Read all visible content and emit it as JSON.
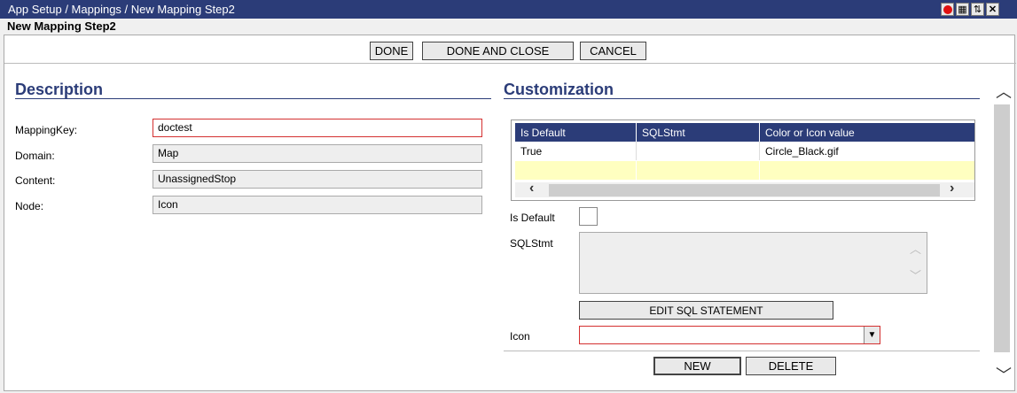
{
  "window": {
    "breadcrumb": "App Setup / Mappings / New Mapping Step2",
    "subtitle": "New Mapping Step2",
    "controls": [
      "record-icon",
      "save-icon",
      "refresh-icon",
      "close-icon"
    ]
  },
  "toolbar": {
    "done_label": "DONE",
    "done_close_label": "DONE AND CLOSE",
    "cancel_label": "CANCEL"
  },
  "description": {
    "title": "Description",
    "fields": {
      "mapping_key": {
        "label": "MappingKey:",
        "value": "doctest"
      },
      "domain": {
        "label": "Domain:",
        "value": "Map"
      },
      "content": {
        "label": "Content:",
        "value": "UnassignedStop"
      },
      "node": {
        "label": "Node:",
        "value": "Icon"
      }
    }
  },
  "customization": {
    "title": "Customization",
    "grid": {
      "columns": [
        "Is Default",
        "SQLStmt",
        "Color or Icon value"
      ],
      "rows": [
        [
          "True",
          "",
          "Circle_Black.gif"
        ],
        [
          "",
          "",
          ""
        ]
      ]
    },
    "is_default_label": "Is Default",
    "sqlstmt_label": "SQLStmt",
    "edit_sql_label": "EDIT SQL STATEMENT",
    "icon_label": "Icon",
    "icon_value": "",
    "new_label": "NEW",
    "delete_label": "DELETE"
  },
  "colors": {
    "header_bg": "#2b3c78",
    "required_border": "#d43030",
    "new_row_bg": "#ffffc0"
  }
}
